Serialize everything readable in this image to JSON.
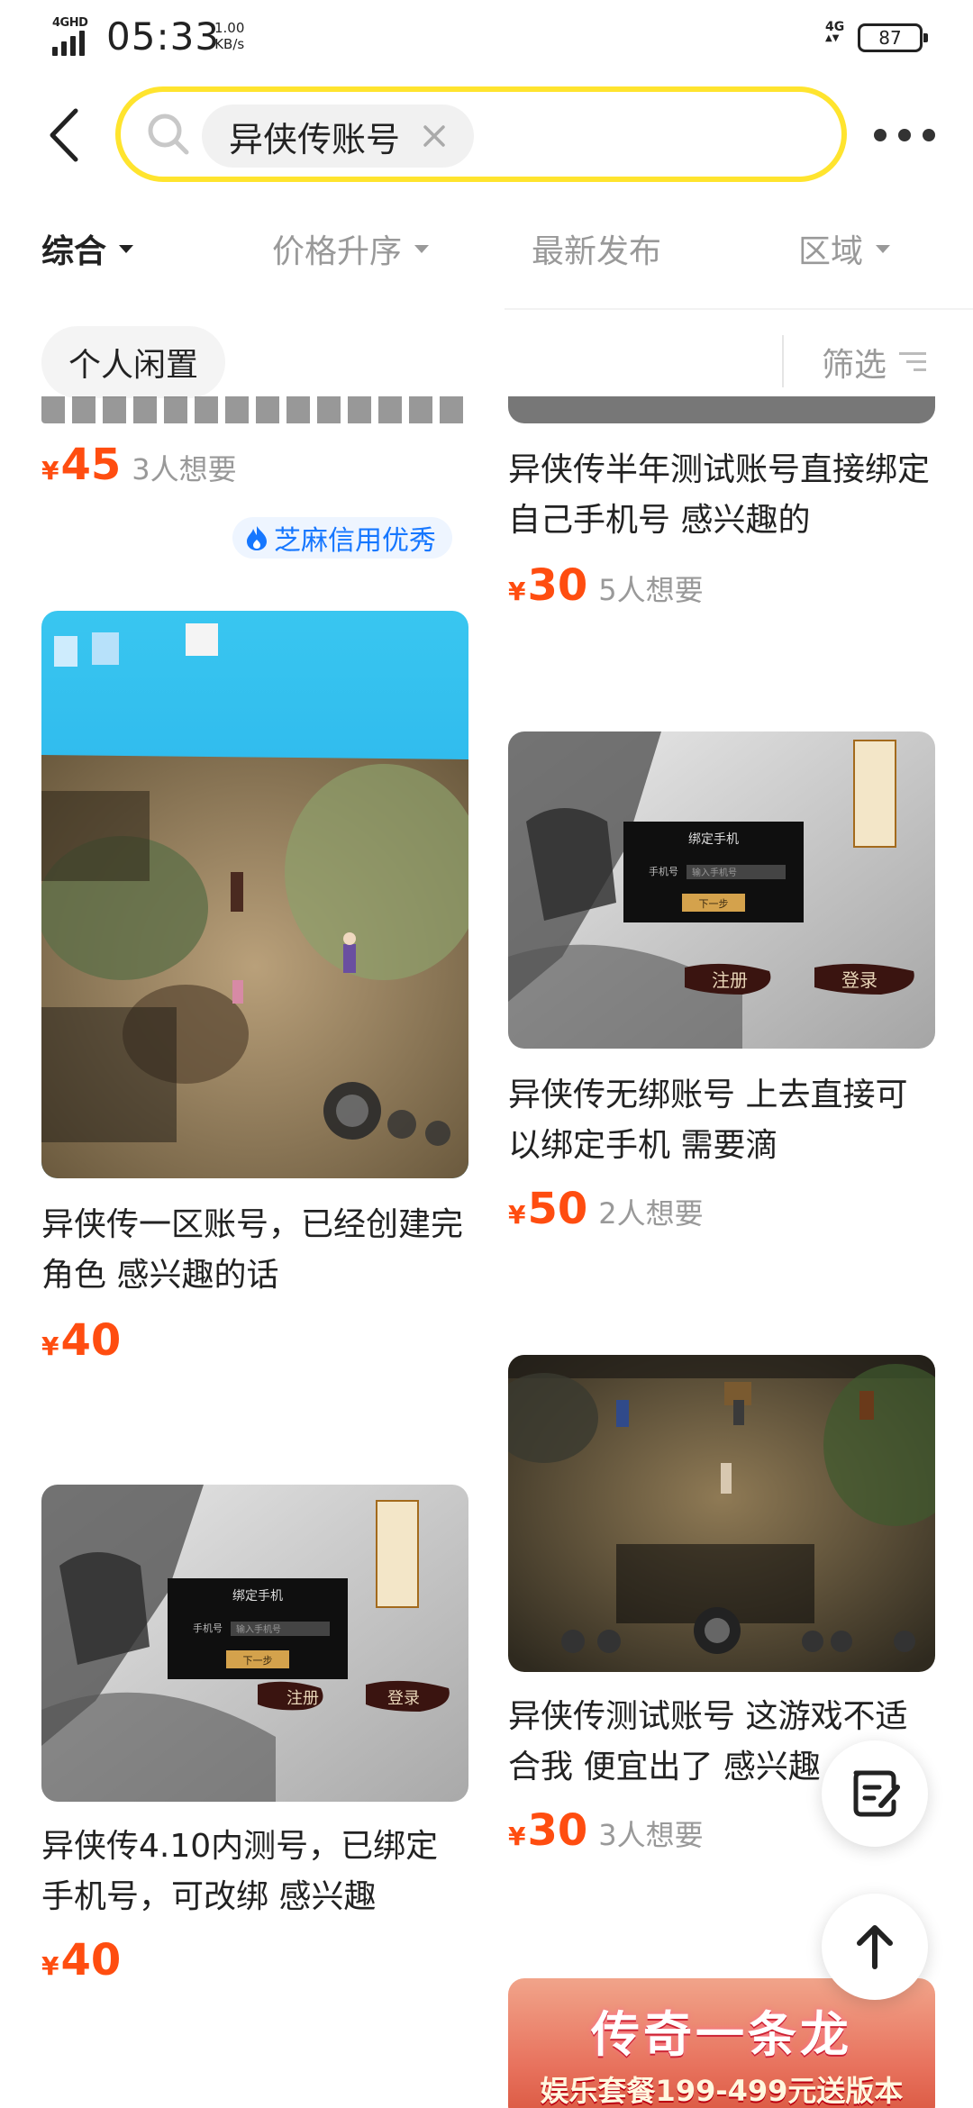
{
  "status": {
    "network_left": "4GHD",
    "time": "05:33",
    "speed_value": "1.00",
    "speed_unit": "KB/s",
    "network_right": "4G",
    "battery": "87"
  },
  "search": {
    "query_chip": "异侠传账号"
  },
  "tabs": [
    {
      "label": "综合",
      "active": true
    },
    {
      "label": "价格升序",
      "active": false
    },
    {
      "label": "最新发布",
      "active": false
    },
    {
      "label": "区域",
      "active": false
    }
  ],
  "filters": {
    "pill": "个人闲置",
    "filter_label": "筛选"
  },
  "left_column": [
    {
      "title": "",
      "price_symbol": "¥",
      "price": "45",
      "wants": "3人想要",
      "badge": "芝麻信用优秀",
      "image": "cut-off-top"
    },
    {
      "title": "异侠传一区账号，已经创建完角色 感兴趣的话",
      "price_symbol": "¥",
      "price": "40",
      "wants": "",
      "image": "game-screen-photo"
    },
    {
      "title": "异侠传4.10内测号，已绑定手机号，可改绑 感兴趣",
      "price_symbol": "¥",
      "price": "40",
      "wants": "",
      "image": "bind-phone-dialog"
    }
  ],
  "right_column": [
    {
      "title": "异侠传半年测试账号直接绑定自己手机号 感兴趣的",
      "price_symbol": "¥",
      "price": "30",
      "wants": "5人想要",
      "image": "cut-off-top"
    },
    {
      "title": "异侠传无绑账号  上去直接可以绑定手机  需要滴",
      "price_symbol": "¥",
      "price": "50",
      "wants": "2人想要",
      "image": "bind-phone-dialog"
    },
    {
      "title": "异侠传测试账号 这游戏不适合我 便宜出了 感兴趣",
      "price_symbol": "¥",
      "price": "30",
      "wants": "3人想要",
      "image": "game-battle-scene"
    },
    {
      "title": "",
      "ad_line1": "传奇一条龙",
      "ad_line2": "娱乐套餐199-499元送版本",
      "image": "ad-banner"
    }
  ],
  "dialog_text": {
    "title": "绑定手机",
    "field_label": "手机号",
    "field_placeholder": "输入手机号",
    "next_button": "下一步",
    "register": "注册",
    "login": "登录"
  },
  "icons": {
    "back": "chevron-left-icon",
    "search": "search-icon",
    "close": "close-icon",
    "more": "more-dots-icon",
    "filter": "filter-icon",
    "edit": "edit-note-icon",
    "top": "arrow-up-icon",
    "badge": "fire-icon"
  },
  "colors": {
    "search_border": "#ffe42e",
    "price": "#ff4d10",
    "badge": "#1677ff",
    "muted": "#999999"
  }
}
